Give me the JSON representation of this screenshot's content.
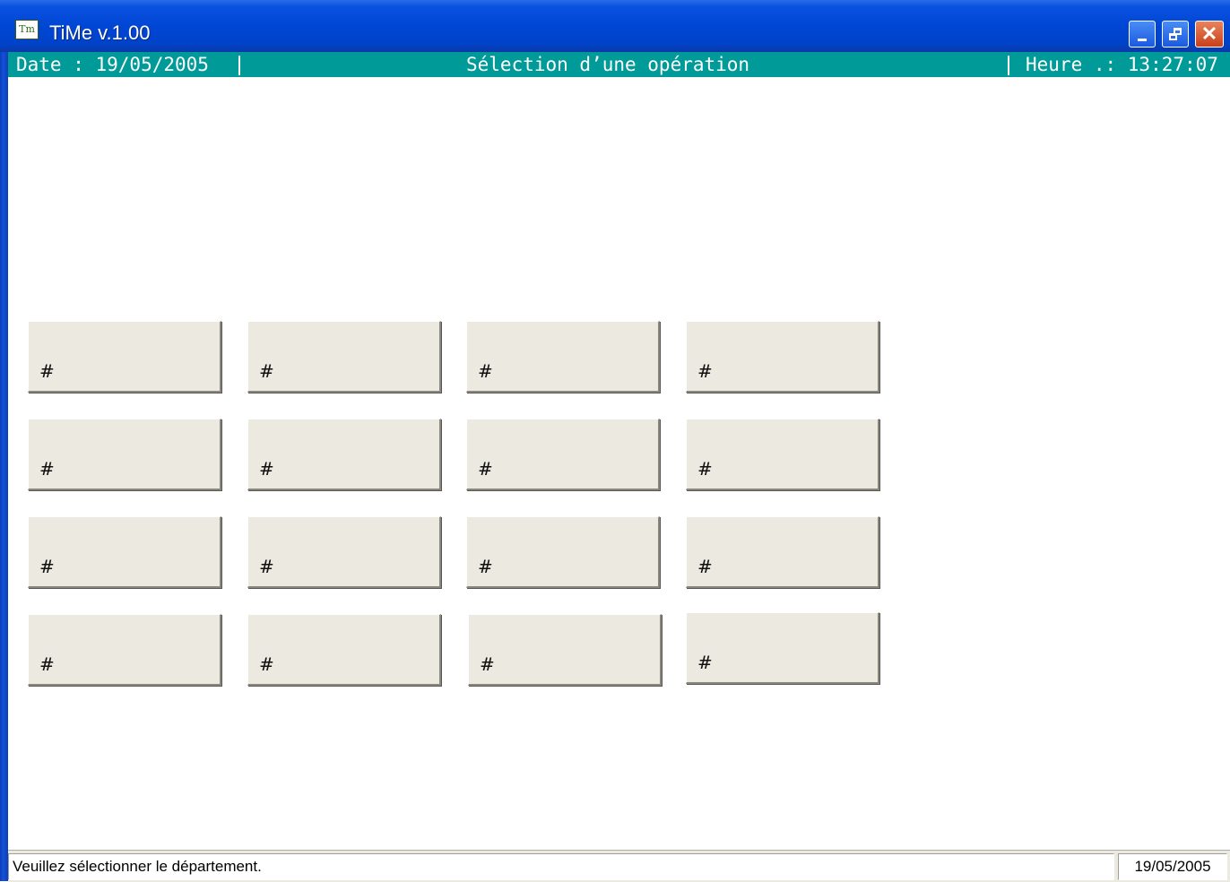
{
  "window": {
    "title": "TiMe v.1.00",
    "icon_text": "Tm",
    "controls": [
      "minimize",
      "restore",
      "close"
    ]
  },
  "infobar": {
    "date": "Date : 19/05/2005",
    "title": "Sélection d’une opération",
    "time": "Heure .: 13:27:07"
  },
  "operations": {
    "buttons": [
      "#",
      "#",
      "#",
      "#",
      "#",
      "#",
      "#",
      "#",
      "#",
      "#",
      "#",
      "#",
      "#",
      "#",
      "#",
      "#"
    ]
  },
  "statusbar": {
    "message": "Veuillez sélectionner le département.",
    "date": "19/05/2005"
  },
  "colors": {
    "titlebar": "#0046d5",
    "infobar": "#009a99",
    "button_face": "#ece9e0"
  }
}
